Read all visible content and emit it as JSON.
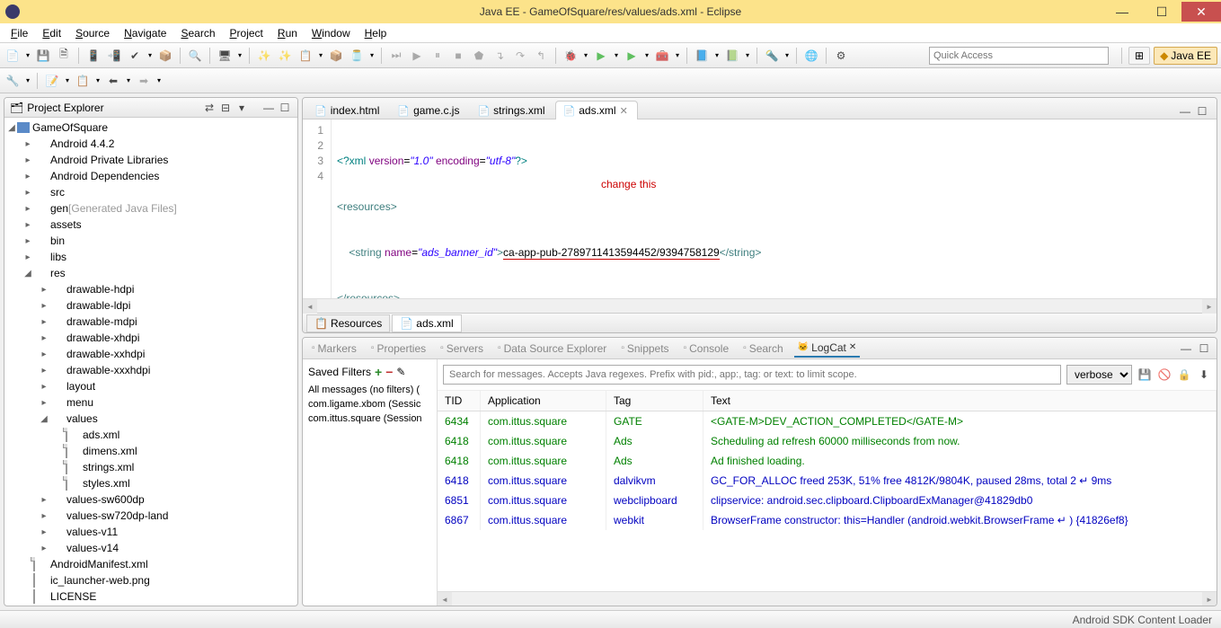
{
  "titlebar": {
    "title": "Java EE - GameOfSquare/res/values/ads.xml - Eclipse"
  },
  "menu": [
    "File",
    "Edit",
    "Source",
    "Navigate",
    "Search",
    "Project",
    "Run",
    "Window",
    "Help"
  ],
  "quick_access_placeholder": "Quick Access",
  "perspectives": {
    "open": "⊞",
    "javaee": "Java EE"
  },
  "project_explorer": {
    "title": "Project Explorer",
    "tree": {
      "project": "GameOfSquare",
      "items": [
        {
          "l": "Android 4.4.2",
          "d": 1,
          "t": "jar",
          "x": "▸"
        },
        {
          "l": "Android Private Libraries",
          "d": 1,
          "t": "jar",
          "x": "▸"
        },
        {
          "l": "Android Dependencies",
          "d": 1,
          "t": "jar",
          "x": "▸"
        },
        {
          "l": "src",
          "d": 1,
          "t": "src",
          "x": "▸"
        },
        {
          "l": "gen",
          "suffix": "[Generated Java Files]",
          "d": 1,
          "t": "src",
          "x": "▸"
        },
        {
          "l": "assets",
          "d": 1,
          "t": "folder",
          "x": "▸"
        },
        {
          "l": "bin",
          "d": 1,
          "t": "folder",
          "x": "▸"
        },
        {
          "l": "libs",
          "d": 1,
          "t": "folder",
          "x": "▸"
        },
        {
          "l": "res",
          "d": 1,
          "t": "folder-open",
          "x": "◢"
        },
        {
          "l": "drawable-hdpi",
          "d": 2,
          "t": "folder",
          "x": "▸"
        },
        {
          "l": "drawable-ldpi",
          "d": 2,
          "t": "folder",
          "x": "▸"
        },
        {
          "l": "drawable-mdpi",
          "d": 2,
          "t": "folder",
          "x": "▸"
        },
        {
          "l": "drawable-xhdpi",
          "d": 2,
          "t": "folder",
          "x": "▸"
        },
        {
          "l": "drawable-xxhdpi",
          "d": 2,
          "t": "folder",
          "x": "▸"
        },
        {
          "l": "drawable-xxxhdpi",
          "d": 2,
          "t": "folder",
          "x": "▸"
        },
        {
          "l": "layout",
          "d": 2,
          "t": "folder",
          "x": "▸"
        },
        {
          "l": "menu",
          "d": 2,
          "t": "folder",
          "x": "▸"
        },
        {
          "l": "values",
          "d": 2,
          "t": "folder-open",
          "x": "◢"
        },
        {
          "l": "ads.xml",
          "d": 3,
          "t": "xml"
        },
        {
          "l": "dimens.xml",
          "d": 3,
          "t": "xml"
        },
        {
          "l": "strings.xml",
          "d": 3,
          "t": "xml"
        },
        {
          "l": "styles.xml",
          "d": 3,
          "t": "xml"
        },
        {
          "l": "values-sw600dp",
          "d": 2,
          "t": "folder",
          "x": "▸"
        },
        {
          "l": "values-sw720dp-land",
          "d": 2,
          "t": "folder",
          "x": "▸"
        },
        {
          "l": "values-v11",
          "d": 2,
          "t": "folder",
          "x": "▸"
        },
        {
          "l": "values-v14",
          "d": 2,
          "t": "folder",
          "x": "▸"
        },
        {
          "l": "AndroidManifest.xml",
          "d": 1,
          "t": "xml-a"
        },
        {
          "l": "ic_launcher-web.png",
          "d": 1,
          "t": "img"
        },
        {
          "l": "LICENSE",
          "d": 1,
          "t": "file"
        }
      ]
    }
  },
  "editor": {
    "tabs": [
      {
        "label": "index.html",
        "icon": "html"
      },
      {
        "label": "game.c.js",
        "icon": "js"
      },
      {
        "label": "strings.xml",
        "icon": "xml"
      },
      {
        "label": "ads.xml",
        "icon": "xml",
        "active": true
      }
    ],
    "line_numbers": [
      "1",
      "2",
      "3",
      "4"
    ],
    "code": {
      "l1_a": "<?xml",
      "l1_b": "version",
      "l1_c": "\"1.0\"",
      "l1_d": "encoding",
      "l1_e": "\"utf-8\"",
      "l1_f": "?>",
      "l2": "<resources>",
      "l3_a": "<string",
      "l3_b": "name",
      "l3_c": "\"ads_banner_id\"",
      "l3_d": ">",
      "l3_e": "ca-app-pub-2789711413594452/9394758129",
      "l3_f": "</string>",
      "l4": "</resources>"
    },
    "annotation": "change this",
    "bottom_tabs": {
      "resources": "Resources",
      "source": "ads.xml"
    }
  },
  "bottom_views": {
    "tabs": [
      "Markers",
      "Properties",
      "Servers",
      "Data Source Explorer",
      "Snippets",
      "Console",
      "Search",
      "LogCat"
    ],
    "active_tab": "LogCat",
    "filters": {
      "title": "Saved Filters",
      "items": [
        "All messages (no filters) (",
        "com.ligame.xbom (Sessic",
        "com.ittus.square (Session"
      ]
    },
    "logcat": {
      "search_placeholder": "Search for messages. Accepts Java regexes. Prefix with pid:, app:, tag: or text: to limit scope.",
      "level": "verbose",
      "headers": {
        "tid": "TID",
        "app": "Application",
        "tag": "Tag",
        "text": "Text"
      },
      "rows": [
        {
          "c": "green",
          "tid": "6434",
          "app": "com.ittus.square",
          "tag": "GATE",
          "text": "<GATE-M>DEV_ACTION_COMPLETED</GATE-M>"
        },
        {
          "c": "green",
          "tid": "6418",
          "app": "com.ittus.square",
          "tag": "Ads",
          "text": "Scheduling ad refresh 60000 milliseconds from now."
        },
        {
          "c": "green",
          "tid": "6418",
          "app": "com.ittus.square",
          "tag": "Ads",
          "text": "Ad finished loading."
        },
        {
          "c": "blue",
          "tid": "6418",
          "app": "com.ittus.square",
          "tag": "dalvikvm",
          "text": "GC_FOR_ALLOC freed 253K, 51% free 4812K/9804K, paused 28ms, total 2 ↵ 9ms"
        },
        {
          "c": "blue",
          "tid": "6851",
          "app": "com.ittus.square",
          "tag": "webclipboard",
          "text": "clipservice: android.sec.clipboard.ClipboardExManager@41829db0"
        },
        {
          "c": "blue",
          "tid": "6867",
          "app": "com.ittus.square",
          "tag": "webkit",
          "text": "BrowserFrame constructor: this=Handler (android.webkit.BrowserFrame ↵ ) {41826ef8}"
        }
      ]
    }
  },
  "statusbar": {
    "text": "Android SDK Content Loader"
  }
}
